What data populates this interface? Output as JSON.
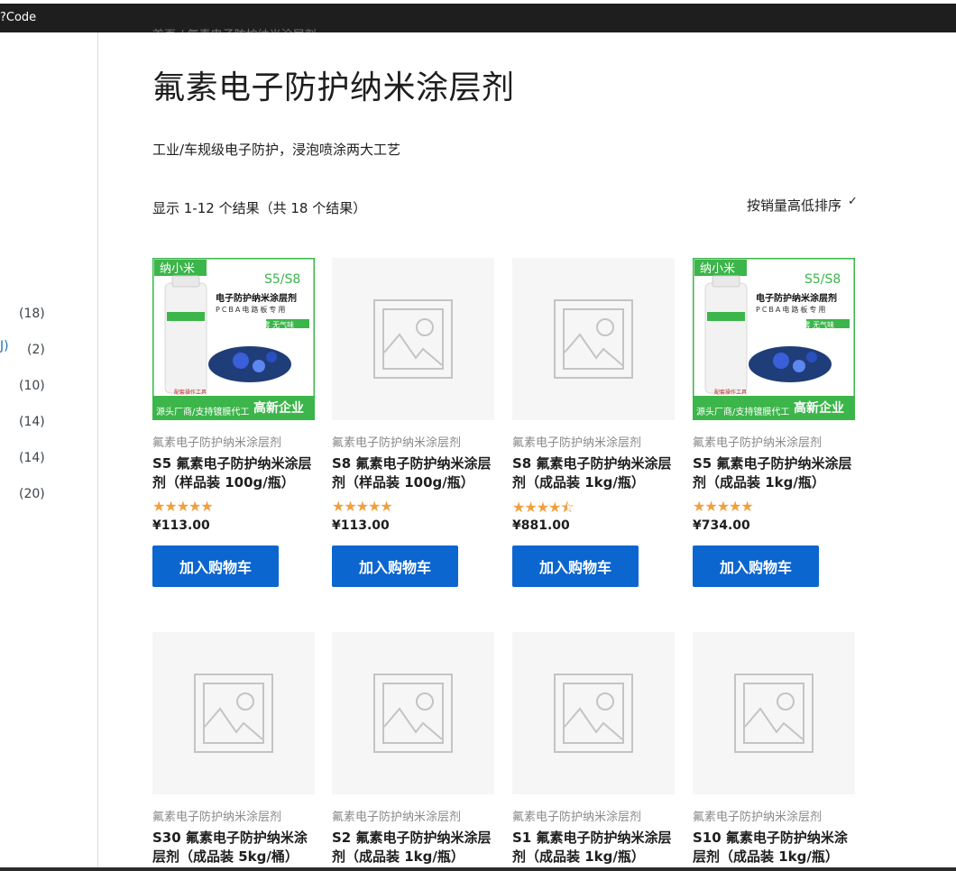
{
  "topbar": {
    "label": "?Code"
  },
  "sidebar": {
    "counts": [
      "(18)",
      "(2)",
      "(10)",
      "(14)",
      "(14)",
      "(20)"
    ],
    "link_fragment": "J)"
  },
  "breadcrumb": "首页 / 氟素电子防护纳米涂层剂",
  "title": "氟素电子防护纳米涂层剂",
  "description": "工业/车规级电子防护，浸泡喷涂两大工艺",
  "result_count": "显示 1-12 个结果（共 18 个结果）",
  "sort": {
    "label": "按销量高低排序",
    "icon": "chevron-down-icon"
  },
  "product_image_text": {
    "brand": "纳小米",
    "model": "S5/S8",
    "headline": "电子防护纳米涂层剂",
    "sub": "PCBA电路板专用",
    "tags": "耐湿热 耐盐雾 无气味",
    "footer_left": "源头厂商/支持镀膜代工",
    "footer_right": "高新企业",
    "bottle_label": "配套操作工具"
  },
  "products": [
    {
      "category": "氟素电子防护纳米涂层剂",
      "name": "S5 氟素电子防护纳米涂层剂（样品装 100g/瓶）",
      "rating": 5,
      "price": "¥113.00",
      "button": "加入购物车",
      "has_image": true
    },
    {
      "category": "氟素电子防护纳米涂层剂",
      "name": "S8 氟素电子防护纳米涂层剂（样品装 100g/瓶）",
      "rating": 5,
      "price": "¥113.00",
      "button": "加入购物车",
      "has_image": false
    },
    {
      "category": "氟素电子防护纳米涂层剂",
      "name": "S8 氟素电子防护纳米涂层剂（成品装 1kg/瓶）",
      "rating": 4.5,
      "price": "¥881.00",
      "button": "加入购物车",
      "has_image": false
    },
    {
      "category": "氟素电子防护纳米涂层剂",
      "name": "S5 氟素电子防护纳米涂层剂（成品装 1kg/瓶）",
      "rating": 5,
      "price": "¥734.00",
      "button": "加入购物车",
      "has_image": true
    },
    {
      "category": "氟素电子防护纳米涂层剂",
      "name": "S30 氟素电子防护纳米涂层剂（成品装 5kg/桶）",
      "has_image": false
    },
    {
      "category": "氟素电子防护纳米涂层剂",
      "name": "S2 氟素电子防护纳米涂层剂（成品装 1kg/瓶）",
      "has_image": false
    },
    {
      "category": "氟素电子防护纳米涂层剂",
      "name": "S1 氟素电子防护纳米涂层剂（成品装 1kg/瓶）",
      "has_image": false
    },
    {
      "category": "氟素电子防护纳米涂层剂",
      "name": "S10 氟素电子防护纳米涂层剂（成品装 1kg/瓶）",
      "has_image": false
    }
  ],
  "colors": {
    "button": "#0b66cf",
    "star": "#f0a040",
    "link": "#2271b1"
  }
}
